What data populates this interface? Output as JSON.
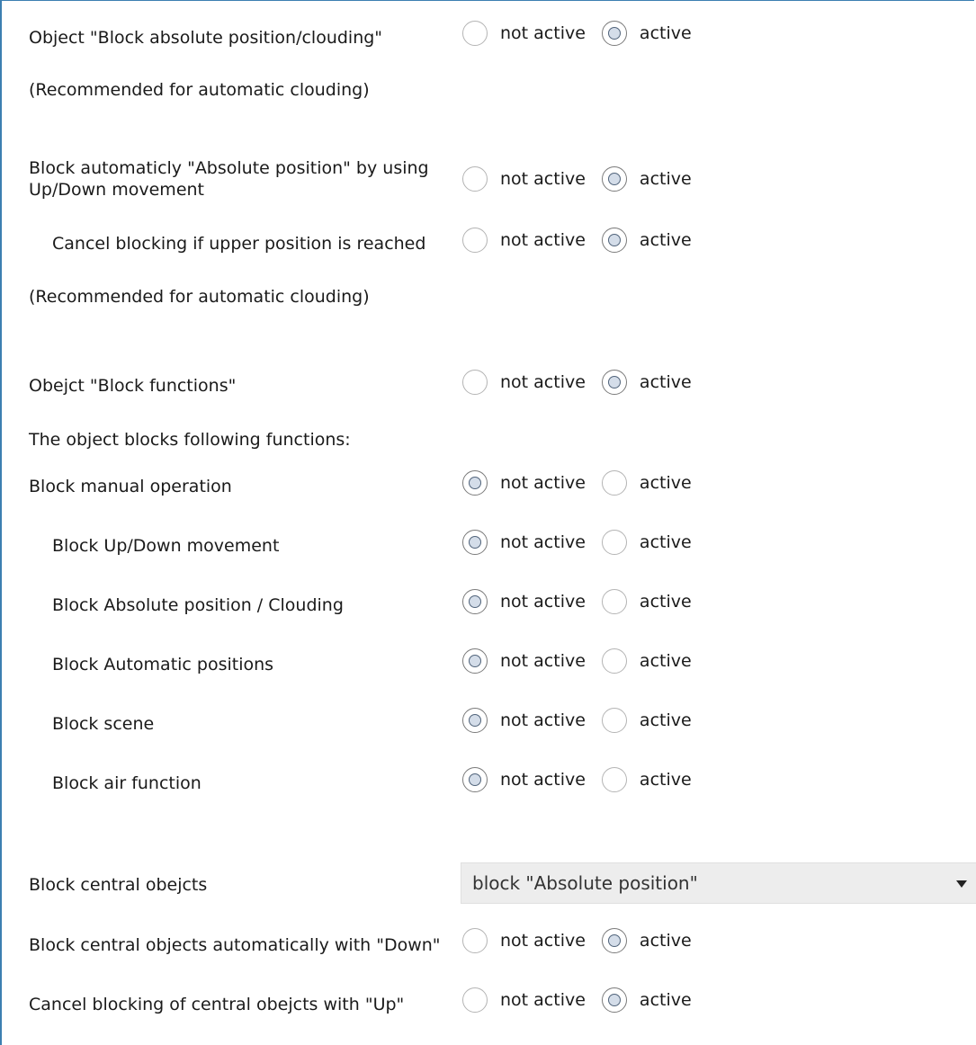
{
  "rows": [
    {
      "label": "Object \"Block absolute position/clouding\"",
      "selected": "active"
    },
    {
      "label": "(Recommended for automatic clouding)"
    },
    {
      "label": "Block automaticly \"Absolute position\" by using Up/Down movement",
      "selected": "active"
    },
    {
      "label": "Cancel blocking if upper position is reached",
      "selected": "active"
    },
    {
      "label": "(Recommended for automatic clouding)"
    },
    {
      "label": "Obejct \"Block functions\"",
      "selected": "active"
    },
    {
      "label": "The object blocks following functions:"
    },
    {
      "label": "Block manual operation",
      "selected": "not active"
    },
    {
      "label": "Block Up/Down movement",
      "selected": "not active"
    },
    {
      "label": "Block Absolute position / Clouding",
      "selected": "not active"
    },
    {
      "label": "Block Automatic positions",
      "selected": "not active"
    },
    {
      "label": "Block scene",
      "selected": "not active"
    },
    {
      "label": "Block air function",
      "selected": "not active"
    },
    {
      "label": "Block central obejcts"
    },
    {
      "label": "Block central objects automatically with \"Down\"",
      "selected": "active"
    },
    {
      "label": "Cancel blocking of central obejcts with \"Up\"",
      "selected": "active"
    }
  ],
  "options": {
    "not_active": "not active",
    "active": "active"
  },
  "dropdown": {
    "value": "block \"Absolute position\""
  }
}
